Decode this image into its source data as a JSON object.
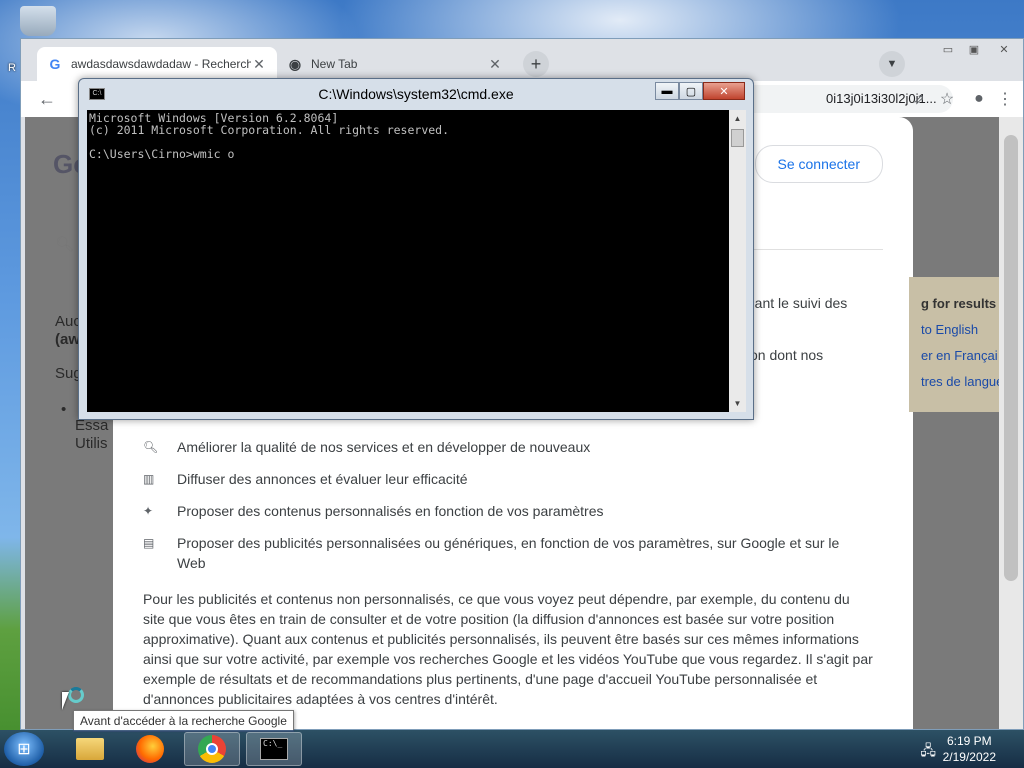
{
  "desktop": {
    "icon_label": "R"
  },
  "chrome": {
    "tabs": [
      {
        "label": "awdasdawsdawdadaw - Recherch",
        "favicon": "G"
      },
      {
        "label": "New Tab",
        "favicon": "chrome-logo-icon"
      }
    ],
    "omnibox_text": "0i13j0i13i30l2j0i1...",
    "signin_label": "Se connecter",
    "bg_logo": "Go",
    "bg_lines": [
      "Auc",
      "(aw",
      "Sug",
      "•",
      "Essa",
      "Utilis"
    ],
    "consent_partial_1": "tuant le suivi des",
    "consent_partial_2": "çon dont nos",
    "consent_items": [
      {
        "icon": "search-icon",
        "text": "Améliorer la qualité de nos services et en développer de nouveaux"
      },
      {
        "icon": "chart-icon",
        "text": "Diffuser des annonces et évaluer leur efficacité"
      },
      {
        "icon": "sparkle-icon",
        "text": "Proposer des contenus personnalisés en fonction de vos paramètres"
      },
      {
        "icon": "ad-icon",
        "text": "Proposer des publicités personnalisées ou génériques, en fonction de vos paramètres, sur Google et sur le Web"
      }
    ],
    "consent_paragraph": "Pour les publicités et contenus non personnalisés, ce que vous voyez peut dépendre, par exemple, du contenu du site que vous êtes en train de consulter et de votre position (la diffusion d'annonces est basée sur votre position approximative). Quant aux contenus et publicités personnalisés, ils peuvent être basés sur ces mêmes informations ainsi que sur votre activité, par exemple vos recherches Google et les vidéos YouTube que vous regardez. Il s'agit par exemple de résultats et de recommandations plus pertinents, d'une page d'accueil YouTube personnalisée et d'annonces publicitaires adaptées à vos centres d'intérêt.",
    "side_panel": [
      "g for results in",
      "to English",
      "er en Françai",
      "tres de langue"
    ]
  },
  "cmd": {
    "title": "C:\\Windows\\system32\\cmd.exe",
    "console_text": "Microsoft Windows [Version 6.2.8064]\n(c) 2011 Microsoft Corporation. All rights reserved.\n\nC:\\Users\\Cirno>wmic o"
  },
  "tooltip": "Avant d'accéder à la recherche Google",
  "taskbar": {
    "time": "6:19 PM",
    "date": "2/19/2022"
  }
}
